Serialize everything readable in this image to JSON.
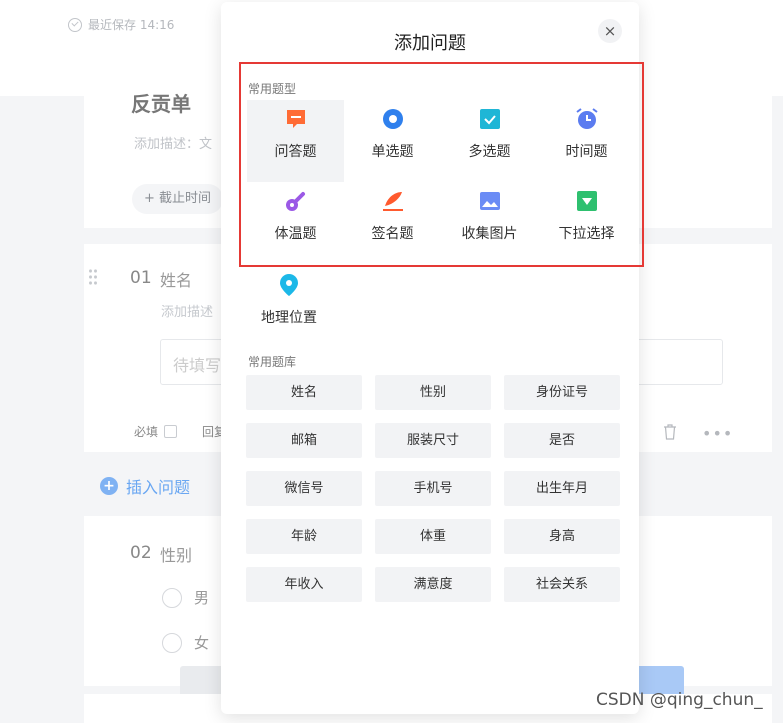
{
  "background": {
    "saved_text": "最近保存 14:16",
    "survey_title": "反贡单",
    "survey_desc": "添加描述：文",
    "deadline_label": "截止时间",
    "q1": {
      "number": "01",
      "title": "姓名",
      "desc": "添加描述",
      "input_placeholder": "待填写",
      "required_label": "必填",
      "more_label": "回复"
    },
    "insert_label": "插入问题",
    "q2": {
      "number": "02",
      "title": "性别",
      "options": [
        "男",
        "女"
      ]
    }
  },
  "modal": {
    "title": "添加问题",
    "close_icon": "×",
    "common_types_label": "常用题型",
    "types": [
      {
        "label": "问答题",
        "icon": "comment-icon",
        "color": "#ff6b35"
      },
      {
        "label": "单选题",
        "icon": "radio-icon",
        "color": "#2f80ed"
      },
      {
        "label": "多选题",
        "icon": "checkbox-icon",
        "color": "#1fb6d6"
      },
      {
        "label": "时间题",
        "icon": "alarm-clock-icon",
        "color": "#5b7cf0"
      },
      {
        "label": "体温题",
        "icon": "thermometer-icon",
        "color": "#9b59e6"
      },
      {
        "label": "签名题",
        "icon": "pen-icon",
        "color": "#ff5a2e"
      },
      {
        "label": "收集图片",
        "icon": "image-icon",
        "color": "#6b8cf5"
      },
      {
        "label": "下拉选择",
        "icon": "dropdown-icon",
        "color": "#2ec06f"
      },
      {
        "label": "地理位置",
        "icon": "location-pin-icon",
        "color": "#1cb8e8"
      }
    ],
    "library_label": "常用题库",
    "library": [
      "姓名",
      "性别",
      "身份证号",
      "邮箱",
      "服装尺寸",
      "是否",
      "微信号",
      "手机号",
      "出生年月",
      "年龄",
      "体重",
      "身高",
      "年收入",
      "满意度",
      "社会关系"
    ]
  },
  "watermark": "CSDN @qing_chun_"
}
